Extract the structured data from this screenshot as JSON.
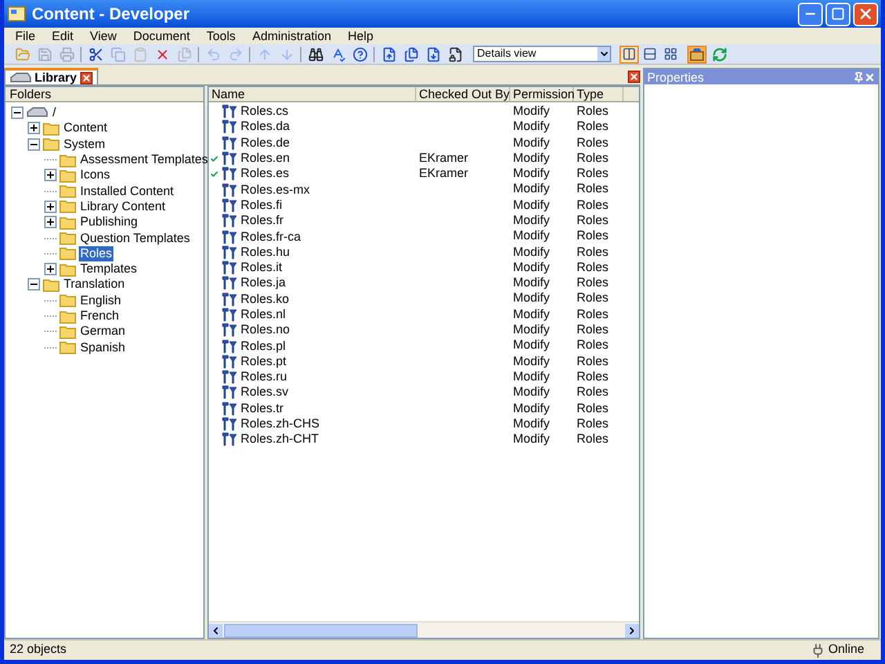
{
  "window": {
    "title": "Content - Developer"
  },
  "menu": [
    "File",
    "Edit",
    "View",
    "Document",
    "Tools",
    "Administration",
    "Help"
  ],
  "toolbar": [
    {
      "disabled": false
    },
    {
      "disabled": true
    },
    {
      "disabled": true
    },
    {
      "disabled": false
    },
    {
      "disabled": true
    },
    {
      "disabled": true
    },
    {
      "disabled": false
    },
    {
      "disabled": true
    },
    {
      "disabled": true
    },
    {
      "disabled": true
    },
    {
      "disabled": true
    },
    {
      "disabled": true
    },
    {
      "disabled": false
    },
    {
      "disabled": false
    },
    {
      "disabled": false
    },
    {
      "disabled": false
    },
    {
      "disabled": false
    },
    {
      "disabled": false
    },
    {
      "disabled": false
    }
  ],
  "view_select": {
    "value": "Details view"
  },
  "view_buttons": [
    {
      "selected": true
    },
    {
      "selected": false
    },
    {
      "selected": false
    }
  ],
  "tab": {
    "label": "Library"
  },
  "folders": {
    "header": "Folders",
    "tree": [
      {
        "label": "/",
        "expanded": true,
        "selected": false,
        "children": [
          {
            "label": "Content",
            "expanded": false,
            "selected": false
          },
          {
            "label": "System",
            "expanded": true,
            "selected": false,
            "children": [
              {
                "label": "Assessment Templates",
                "selected": false
              },
              {
                "label": "Icons",
                "expanded": false,
                "selected": false
              },
              {
                "label": "Installed Content",
                "selected": false
              },
              {
                "label": "Library Content",
                "expanded": false,
                "selected": false
              },
              {
                "label": "Publishing",
                "expanded": false,
                "selected": false
              },
              {
                "label": "Question Templates",
                "selected": false
              },
              {
                "label": "Roles",
                "selected": true
              },
              {
                "label": "Templates",
                "expanded": false,
                "selected": false
              }
            ]
          },
          {
            "label": "Translation",
            "expanded": true,
            "selected": false,
            "children": [
              {
                "label": "English",
                "selected": false
              },
              {
                "label": "French",
                "selected": false
              },
              {
                "label": "German",
                "selected": false
              },
              {
                "label": "Spanish",
                "selected": false
              }
            ]
          }
        ]
      }
    ]
  },
  "table": {
    "columns": [
      "Name",
      "Checked Out By",
      "Permission",
      "Type"
    ],
    "rows": [
      {
        "name": "Roles.cs",
        "checked_out": false,
        "checked_out_by": "",
        "permission": "Modify",
        "type": "Roles"
      },
      {
        "name": "Roles.da",
        "checked_out": false,
        "checked_out_by": "",
        "permission": "Modify",
        "type": "Roles"
      },
      {
        "name": "Roles.de",
        "checked_out": false,
        "checked_out_by": "",
        "permission": "Modify",
        "type": "Roles"
      },
      {
        "name": "Roles.en",
        "checked_out": true,
        "checked_out_by": "EKramer",
        "permission": "Modify",
        "type": "Roles"
      },
      {
        "name": "Roles.es",
        "checked_out": true,
        "checked_out_by": "EKramer",
        "permission": "Modify",
        "type": "Roles"
      },
      {
        "name": "Roles.es-mx",
        "checked_out": false,
        "checked_out_by": "",
        "permission": "Modify",
        "type": "Roles"
      },
      {
        "name": "Roles.fi",
        "checked_out": false,
        "checked_out_by": "",
        "permission": "Modify",
        "type": "Roles"
      },
      {
        "name": "Roles.fr",
        "checked_out": false,
        "checked_out_by": "",
        "permission": "Modify",
        "type": "Roles"
      },
      {
        "name": "Roles.fr-ca",
        "checked_out": false,
        "checked_out_by": "",
        "permission": "Modify",
        "type": "Roles"
      },
      {
        "name": "Roles.hu",
        "checked_out": false,
        "checked_out_by": "",
        "permission": "Modify",
        "type": "Roles"
      },
      {
        "name": "Roles.it",
        "checked_out": false,
        "checked_out_by": "",
        "permission": "Modify",
        "type": "Roles"
      },
      {
        "name": "Roles.ja",
        "checked_out": false,
        "checked_out_by": "",
        "permission": "Modify",
        "type": "Roles"
      },
      {
        "name": "Roles.ko",
        "checked_out": false,
        "checked_out_by": "",
        "permission": "Modify",
        "type": "Roles"
      },
      {
        "name": "Roles.nl",
        "checked_out": false,
        "checked_out_by": "",
        "permission": "Modify",
        "type": "Roles"
      },
      {
        "name": "Roles.no",
        "checked_out": false,
        "checked_out_by": "",
        "permission": "Modify",
        "type": "Roles"
      },
      {
        "name": "Roles.pl",
        "checked_out": false,
        "checked_out_by": "",
        "permission": "Modify",
        "type": "Roles"
      },
      {
        "name": "Roles.pt",
        "checked_out": false,
        "checked_out_by": "",
        "permission": "Modify",
        "type": "Roles"
      },
      {
        "name": "Roles.ru",
        "checked_out": false,
        "checked_out_by": "",
        "permission": "Modify",
        "type": "Roles"
      },
      {
        "name": "Roles.sv",
        "checked_out": false,
        "checked_out_by": "",
        "permission": "Modify",
        "type": "Roles"
      },
      {
        "name": "Roles.tr",
        "checked_out": false,
        "checked_out_by": "",
        "permission": "Modify",
        "type": "Roles"
      },
      {
        "name": "Roles.zh-CHS",
        "checked_out": false,
        "checked_out_by": "",
        "permission": "Modify",
        "type": "Roles"
      },
      {
        "name": "Roles.zh-CHT",
        "checked_out": false,
        "checked_out_by": "",
        "permission": "Modify",
        "type": "Roles"
      }
    ]
  },
  "properties": {
    "title": "Properties"
  },
  "status_bar": {
    "count": "22 objects",
    "connection": "Online"
  }
}
